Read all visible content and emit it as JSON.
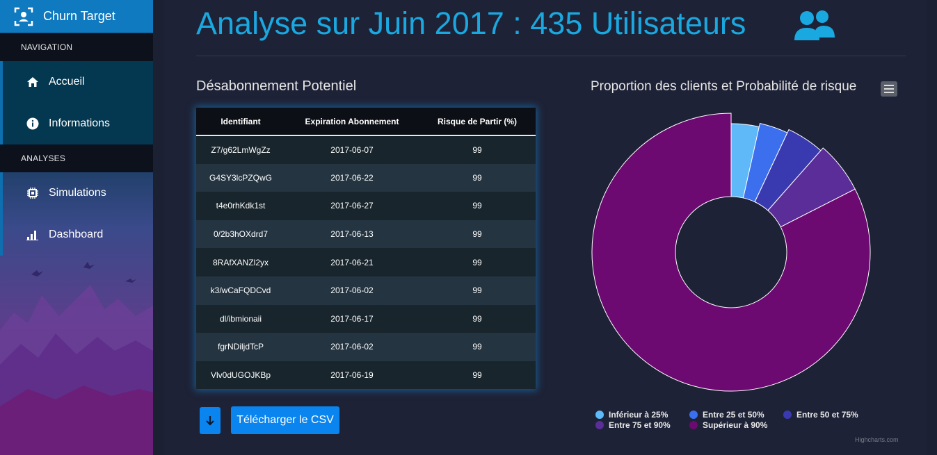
{
  "brand": {
    "name": "Churn Target"
  },
  "sidebar": {
    "sections": [
      {
        "label": "NAVIGATION"
      },
      {
        "label": "ANALYSES"
      }
    ],
    "items": [
      {
        "label": "Accueil",
        "icon": "home-icon"
      },
      {
        "label": "Informations",
        "icon": "info-icon"
      },
      {
        "label": "Simulations",
        "icon": "chip-icon"
      },
      {
        "label": "Dashboard",
        "icon": "bar-chart-icon"
      }
    ]
  },
  "header": {
    "title": "Analyse sur Juin 2017 : 435 Utilisateurs",
    "icon": "users-icon",
    "color": "#1aa8e0"
  },
  "table": {
    "title": "Désabonnement Potentiel",
    "columns": [
      "Identifiant",
      "Expiration Abonnement",
      "Risque de Partir (%)"
    ],
    "rows": [
      [
        "Z7/g62LmWgZz",
        "2017-06-07",
        "99"
      ],
      [
        "G4SY3lcPZQwG",
        "2017-06-22",
        "99"
      ],
      [
        "t4e0rhKdk1st",
        "2017-06-27",
        "99"
      ],
      [
        "0/2b3hOXdrd7",
        "2017-06-13",
        "99"
      ],
      [
        "8RAfXANZl2yx",
        "2017-06-21",
        "99"
      ],
      [
        "k3/wCaFQDCvd",
        "2017-06-02",
        "99"
      ],
      [
        "dl/ibmionaii",
        "2017-06-17",
        "99"
      ],
      [
        "fgrNDiljdTcP",
        "2017-06-02",
        "99"
      ],
      [
        "Vlv0dUGOJKBp",
        "2017-06-19",
        "99"
      ]
    ],
    "download_label": "Télécharger le CSV"
  },
  "chart_data": {
    "type": "pie",
    "variant": "donut",
    "title": "Proportion des clients et Probabilité de risque",
    "categories": [
      "Inférieur à 25%",
      "Entre 25 et 50%",
      "Entre 50 et 75%",
      "Entre 75 et 90%",
      "Supérieur à 90%"
    ],
    "values": [
      3.5,
      3.5,
      4.5,
      6,
      82.5
    ],
    "colors": [
      "#5fb8f8",
      "#3b6fee",
      "#3a3ab0",
      "#5a2d98",
      "#6c0a72"
    ],
    "legend_placement": "bottom",
    "credits": "Highcharts.com"
  }
}
